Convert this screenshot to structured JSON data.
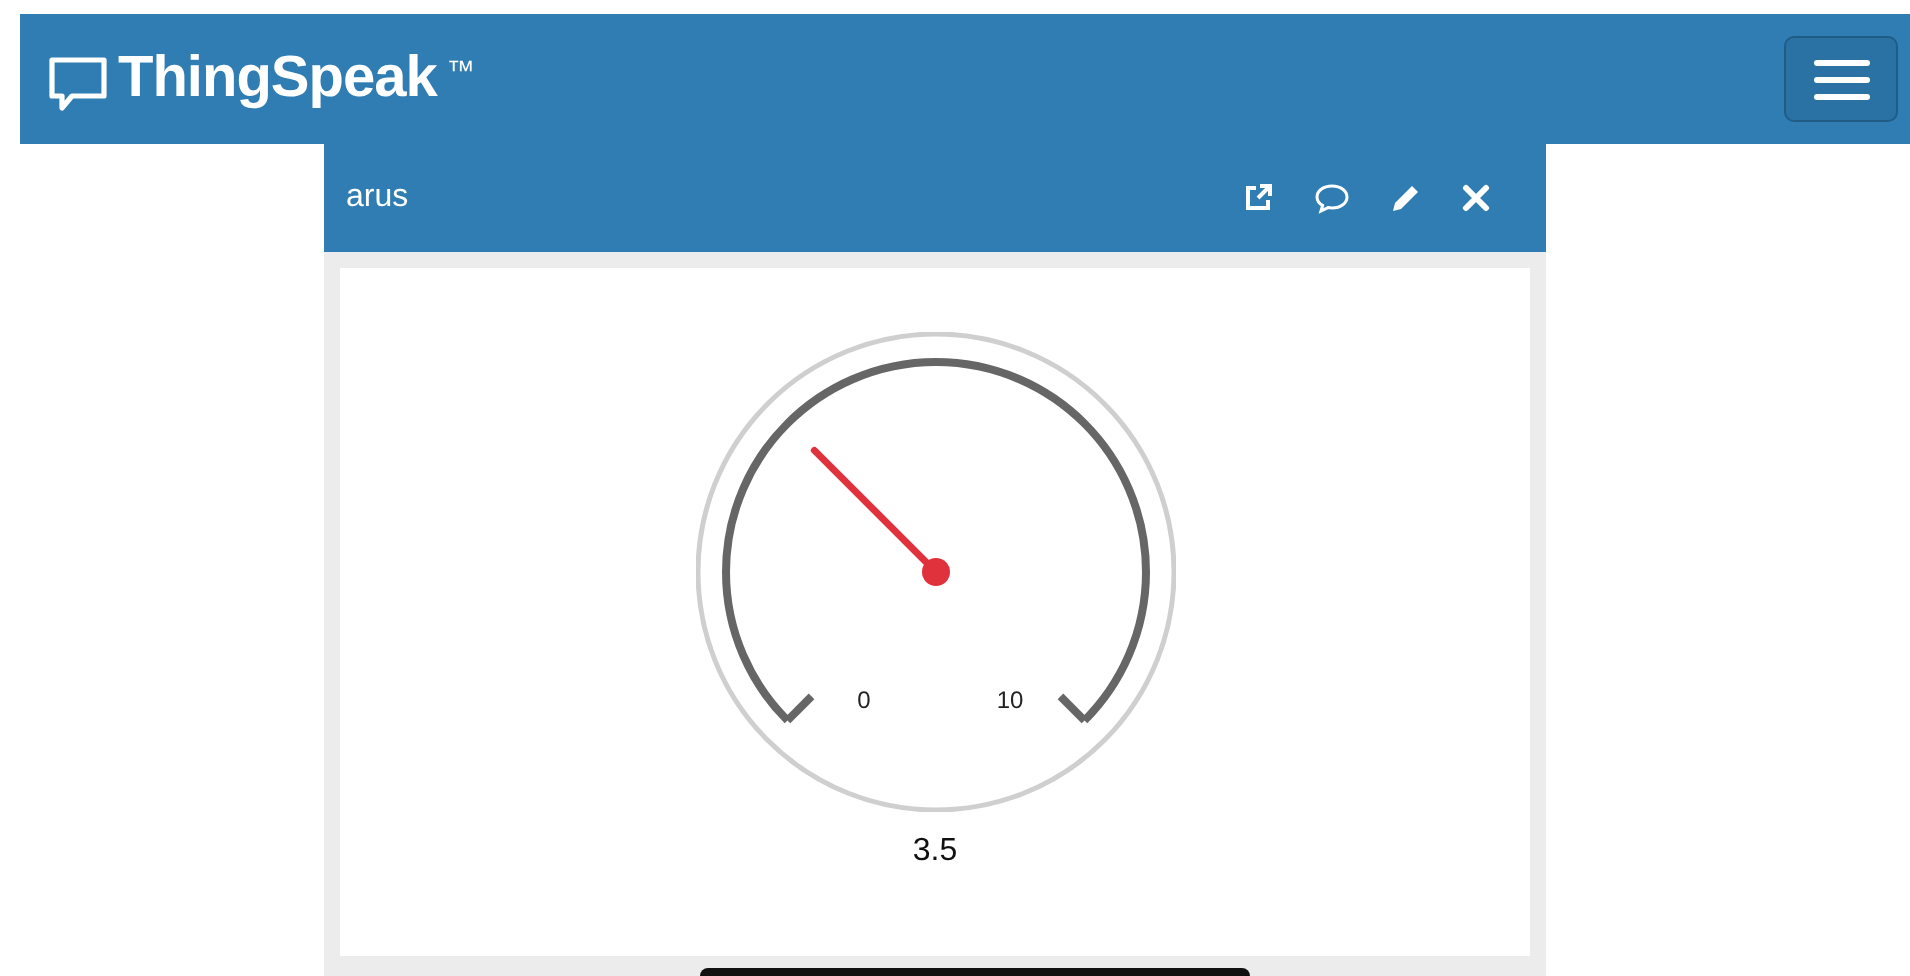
{
  "navbar": {
    "brand": "ThingSpeak",
    "trademark": "™"
  },
  "widget": {
    "title": "arus",
    "actions": [
      {
        "kind": "popout"
      },
      {
        "kind": "comment"
      },
      {
        "kind": "edit"
      },
      {
        "kind": "close"
      }
    ],
    "gauge": {
      "min_label": "0",
      "max_label": "10",
      "value": "3.5"
    }
  }
}
